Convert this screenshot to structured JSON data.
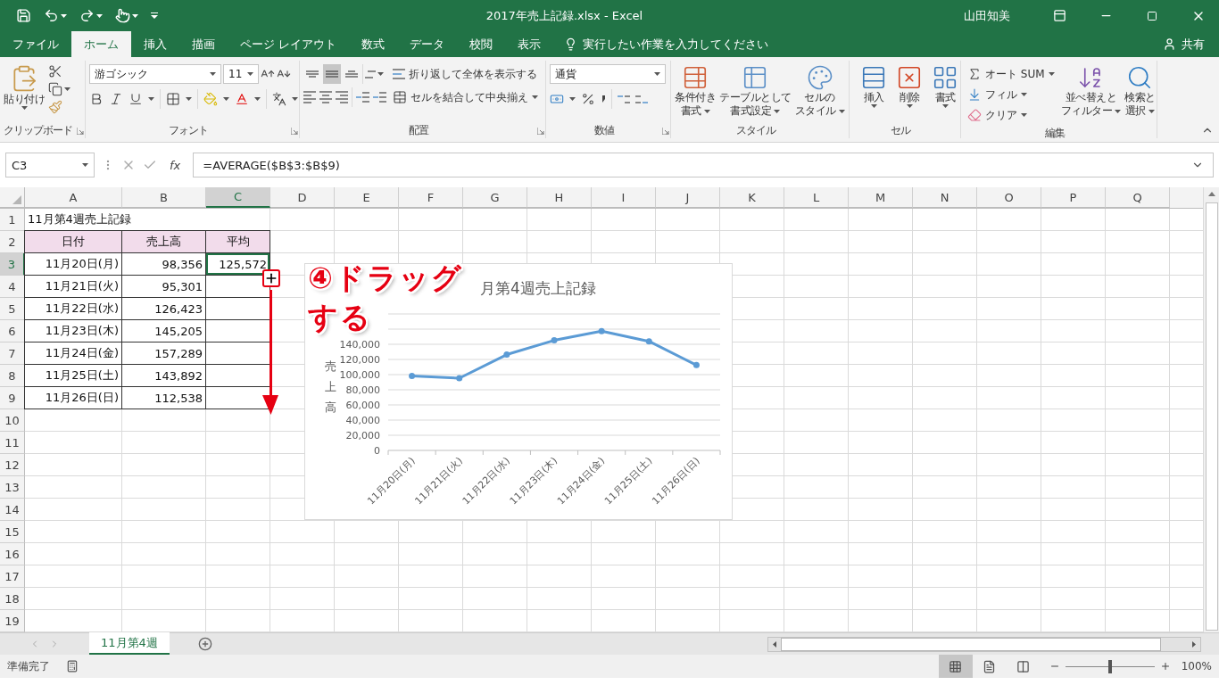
{
  "window": {
    "title": "2017年売上記録.xlsx - Excel",
    "user": "山田知美"
  },
  "tabs": [
    {
      "label": "ファイル",
      "selected": false
    },
    {
      "label": "ホーム",
      "selected": true
    },
    {
      "label": "挿入",
      "selected": false
    },
    {
      "label": "描画",
      "selected": false
    },
    {
      "label": "ページ レイアウト",
      "selected": false
    },
    {
      "label": "数式",
      "selected": false
    },
    {
      "label": "データ",
      "selected": false
    },
    {
      "label": "校閲",
      "selected": false
    },
    {
      "label": "表示",
      "selected": false
    }
  ],
  "tell_me": {
    "placeholder": "実行したい作業を入力してください"
  },
  "share": "共有",
  "ribbon": {
    "clipboard": {
      "paste": "貼り付け",
      "label": "クリップボード"
    },
    "font": {
      "name": "游ゴシック",
      "size": "11",
      "label": "フォント"
    },
    "alignment": {
      "vertical": [
        {
          "kind": "top",
          "selected": false
        },
        {
          "kind": "middle",
          "selected": true
        },
        {
          "kind": "bottom",
          "selected": false
        }
      ],
      "wrap": "折り返して全体を表示する",
      "merge": "セルを結合して中央揃え",
      "label": "配置"
    },
    "number": {
      "format": "通貨",
      "label": "数値"
    },
    "styles": {
      "buttons": [
        {
          "lines": [
            "条件付き",
            "書式"
          ]
        },
        {
          "lines": [
            "テーブルとして",
            "書式設定"
          ]
        },
        {
          "lines": [
            "セルの",
            "スタイル"
          ]
        }
      ],
      "label": "スタイル"
    },
    "cells": {
      "buttons": [
        {
          "lines": [
            "挿入"
          ]
        },
        {
          "lines": [
            "削除"
          ]
        },
        {
          "lines": [
            "書式"
          ]
        }
      ],
      "label": "セル"
    },
    "editing": {
      "autosum": "オート SUM",
      "fill": "フィル",
      "clear": "クリア",
      "buttons": [
        {
          "lines": [
            "並べ替えと",
            "フィルター"
          ]
        },
        {
          "lines": [
            "検索と",
            "選択"
          ]
        }
      ],
      "label": "編集"
    }
  },
  "formula_bar": {
    "name_box": "C3",
    "fx": "fx",
    "formula": "=AVERAGE($B$3:$B$9)"
  },
  "sheet": {
    "columns": [
      {
        "label": "A",
        "selected": false
      },
      {
        "label": "B",
        "selected": false
      },
      {
        "label": "C",
        "selected": true
      },
      {
        "label": "D",
        "selected": false
      },
      {
        "label": "E",
        "selected": false
      },
      {
        "label": "F",
        "selected": false
      },
      {
        "label": "G",
        "selected": false
      },
      {
        "label": "H",
        "selected": false
      },
      {
        "label": "I",
        "selected": false
      },
      {
        "label": "J",
        "selected": false
      },
      {
        "label": "K",
        "selected": false
      },
      {
        "label": "L",
        "selected": false
      },
      {
        "label": "M",
        "selected": false
      },
      {
        "label": "N",
        "selected": false
      },
      {
        "label": "O",
        "selected": false
      },
      {
        "label": "P",
        "selected": false
      },
      {
        "label": "Q",
        "selected": false
      }
    ],
    "rows": [
      {
        "header": "1",
        "selected": false,
        "cells": [
          {
            "text": "11月第4週売上記録",
            "kind": "title",
            "selected": false
          }
        ]
      },
      {
        "header": "2",
        "selected": false,
        "cells": [
          {
            "text": "日付",
            "kind": "header",
            "selected": false
          },
          {
            "text": "売上高",
            "kind": "header",
            "selected": false
          },
          {
            "text": "平均",
            "kind": "header",
            "selected": false
          }
        ]
      },
      {
        "header": "3",
        "selected": true,
        "cells": [
          {
            "text": "11月20日(月)",
            "kind": "value",
            "selected": false
          },
          {
            "text": "98,356",
            "kind": "value",
            "selected": false
          },
          {
            "text": "125,572",
            "kind": "value",
            "selected": true
          }
        ]
      },
      {
        "header": "4",
        "selected": false,
        "cells": [
          {
            "text": "11月21日(火)",
            "kind": "value",
            "selected": false
          },
          {
            "text": "95,301",
            "kind": "value",
            "selected": false
          },
          {
            "kind": "value",
            "selected": false
          }
        ]
      },
      {
        "header": "5",
        "selected": false,
        "cells": [
          {
            "text": "11月22日(水)",
            "kind": "value",
            "selected": false
          },
          {
            "text": "126,423",
            "kind": "value",
            "selected": false
          },
          {
            "kind": "value",
            "selected": false
          }
        ]
      },
      {
        "header": "6",
        "selected": false,
        "cells": [
          {
            "text": "11月23日(木)",
            "kind": "value",
            "selected": false
          },
          {
            "text": "145,205",
            "kind": "value",
            "selected": false
          },
          {
            "kind": "value",
            "selected": false
          }
        ]
      },
      {
        "header": "7",
        "selected": false,
        "cells": [
          {
            "text": "11月24日(金)",
            "kind": "value",
            "selected": false
          },
          {
            "text": "157,289",
            "kind": "value",
            "selected": false
          },
          {
            "kind": "value",
            "selected": false
          }
        ]
      },
      {
        "header": "8",
        "selected": false,
        "cells": [
          {
            "text": "11月25日(土)",
            "kind": "value",
            "selected": false
          },
          {
            "text": "143,892",
            "kind": "value",
            "selected": false
          },
          {
            "kind": "value",
            "selected": false
          }
        ]
      },
      {
        "header": "9",
        "selected": false,
        "cells": [
          {
            "text": "11月26日(日)",
            "kind": "value",
            "selected": false
          },
          {
            "text": "112,538",
            "kind": "value",
            "selected": false
          },
          {
            "kind": "value",
            "selected": false
          }
        ]
      },
      {
        "header": "10",
        "selected": false
      },
      {
        "header": "11",
        "selected": false
      },
      {
        "header": "12",
        "selected": false
      },
      {
        "header": "13",
        "selected": false
      },
      {
        "header": "14",
        "selected": false
      },
      {
        "header": "15",
        "selected": false
      },
      {
        "header": "16",
        "selected": false
      },
      {
        "header": "17",
        "selected": false
      },
      {
        "header": "18",
        "selected": false
      },
      {
        "header": "19",
        "selected": false
      }
    ]
  },
  "chart": {
    "chart_data": {
      "type": "line",
      "title": "月第4週売上記録",
      "ylabel": "売上高",
      "categories": [
        "11月20日(月)",
        "11月21日(火)",
        "11月22日(水)",
        "11月23日(木)",
        "11月24日(金)",
        "11月25日(土)",
        "11月26日(日)"
      ],
      "series": [
        {
          "color": "#5b9bd5",
          "marker": "circle",
          "values": [
            98356,
            95301,
            126423,
            145205,
            157289,
            143892,
            112538
          ]
        }
      ],
      "grid": true,
      "ylim": [
        0,
        180000
      ],
      "yticks": [
        {
          "value": 0,
          "label": "0"
        },
        {
          "value": 20000,
          "label": "20,000"
        },
        {
          "value": 40000,
          "label": "40,000"
        },
        {
          "value": 60000,
          "label": "60,000"
        },
        {
          "value": 80000,
          "label": "80,000"
        },
        {
          "value": 100000,
          "label": "100,000"
        },
        {
          "value": 120000,
          "label": "120,000"
        },
        {
          "value": 140000,
          "label": "140,000"
        }
      ]
    }
  },
  "annotation": {
    "lines": [
      "④ドラッグ",
      "する"
    ]
  },
  "sheet_tabs": [
    {
      "label": "11月第4週",
      "selected": true
    }
  ],
  "status_bar": {
    "status": "準備完了",
    "views": [
      {
        "kind": "normal",
        "selected": true
      },
      {
        "kind": "page_layout",
        "selected": false
      },
      {
        "kind": "page_break",
        "selected": false
      }
    ],
    "level": 0.5,
    "zoom": "100%"
  }
}
